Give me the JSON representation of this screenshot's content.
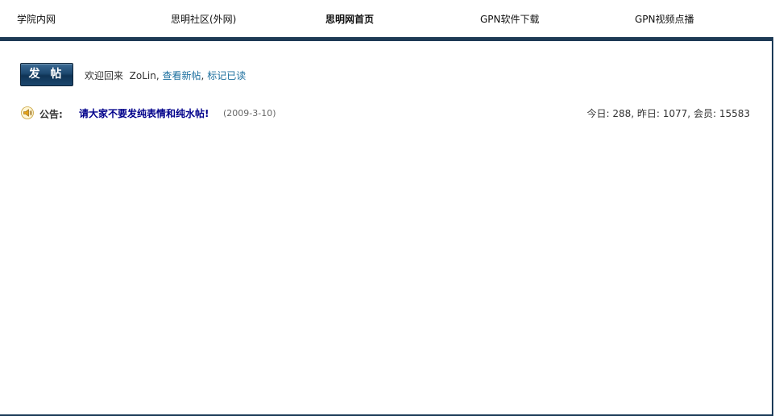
{
  "nav": {
    "items": [
      {
        "label": "学院内网"
      },
      {
        "label": "思明社区(外网)"
      },
      {
        "label": "思明网首页"
      },
      {
        "label": "GPN软件下载"
      },
      {
        "label": "GPN视频点播"
      }
    ]
  },
  "actions": {
    "post_label": "发 帖"
  },
  "welcome": {
    "greeting": "欢迎回来",
    "username": "ZoLin",
    "sep1": ",",
    "view_new": "查看新帖",
    "sep2": ",",
    "mark_read": "标记已读"
  },
  "announcement": {
    "label": "公告:",
    "title": "请大家不要发纯表情和纯水帖!",
    "date": "(2009-3-10)"
  },
  "stats": {
    "today_label": "今日:",
    "today": "288",
    "yesterday_label": "昨日:",
    "yesterday": "1077",
    "members_label": "会员:",
    "members": "15583"
  },
  "colors": {
    "nav_rule": "#1e3a55",
    "link": "#1a6e9e",
    "announcement_link": "#00008b"
  }
}
